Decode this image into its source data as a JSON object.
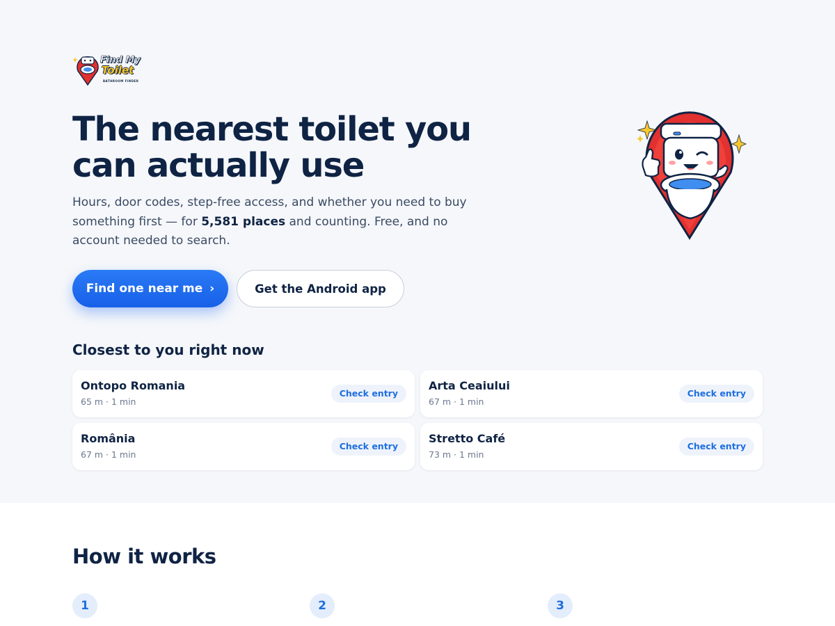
{
  "brand": {
    "logo_line1": "Find My",
    "logo_line2": "Toilet",
    "logo_tagline": "BATHROOM FINDER"
  },
  "hero": {
    "headline": "The nearest toilet you can actually use",
    "sub_before": "Hours, door codes, step-free access, and whether you need to buy something first — for ",
    "sub_bold": "5,581 places",
    "sub_after": " and counting. Free, and no account needed to search.",
    "primary_button": "Find one near me",
    "primary_button_icon": "chevron-right-icon",
    "secondary_button": "Get the Android app"
  },
  "closest": {
    "title": "Closest to you right now",
    "items": [
      {
        "name": "Ontopo Romania",
        "meta": "65 m · 1 min",
        "badge": "Check entry"
      },
      {
        "name": "Arta Ceaiului",
        "meta": "67 m · 1 min",
        "badge": "Check entry"
      },
      {
        "name": "România",
        "meta": "67 m · 1 min",
        "badge": "Check entry"
      },
      {
        "name": "Stretto Café",
        "meta": "73 m · 1 min",
        "badge": "Check entry"
      }
    ]
  },
  "how": {
    "title": "How it works",
    "steps": [
      "1",
      "2",
      "3"
    ]
  },
  "colors": {
    "accent": "#1f6fe0",
    "primary_button": "#1760e8",
    "navy": "#0f2344",
    "hero_bg": "#f5f7fa",
    "mascot_pin": "#e2312f",
    "logo_yellow": "#f7c72e"
  }
}
